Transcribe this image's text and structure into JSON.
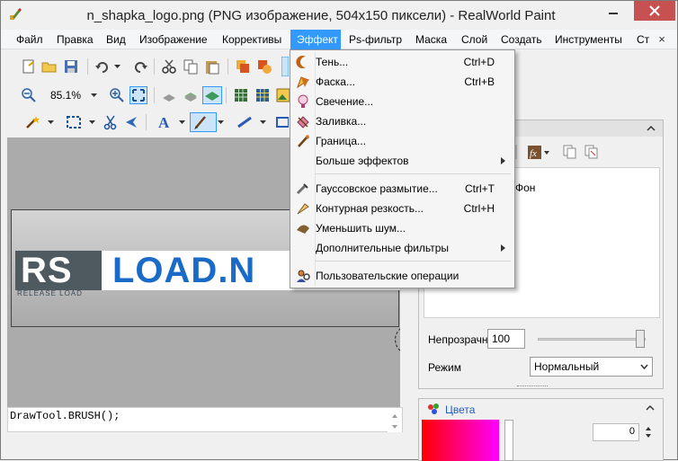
{
  "window": {
    "title": "n_shapka_logo.png (PNG изображение, 504x150 пиксели) - RealWorld Paint"
  },
  "menubar": {
    "items": [
      "Файл",
      "Правка",
      "Вид",
      "Изображение",
      "Коррективы",
      "Эффект",
      "Ps-фильтр",
      "Маска",
      "Слой",
      "Создать",
      "Инструменты",
      "Ст"
    ],
    "close": "×"
  },
  "toolbar": {
    "zoom": "85.1%"
  },
  "effect_menu": {
    "items": [
      {
        "label": "Тень...",
        "shortcut": "Ctrl+D",
        "icon": "shadow-icon"
      },
      {
        "label": "Фаска...",
        "shortcut": "Ctrl+B",
        "icon": "bevel-icon"
      },
      {
        "label": "Свечение...",
        "shortcut": "",
        "icon": "glow-icon"
      },
      {
        "label": "Заливка...",
        "shortcut": "",
        "icon": "fill-icon"
      },
      {
        "label": "Граница...",
        "shortcut": "",
        "icon": "border-icon"
      },
      {
        "label": "Больше эффектов",
        "shortcut": "",
        "icon": "",
        "submenu": true
      },
      {
        "label": "Гауссовское размытие...",
        "shortcut": "Ctrl+T",
        "icon": "blur-icon"
      },
      {
        "label": "Контурная резкость...",
        "shortcut": "Ctrl+H",
        "icon": "sharpen-icon"
      },
      {
        "label": "Уменьшить шум...",
        "shortcut": "",
        "icon": "denoise-icon"
      },
      {
        "label": "Дополнительные фильтры",
        "shortcut": "",
        "icon": "",
        "submenu": true
      },
      {
        "label": "Пользовательские операции",
        "shortcut": "",
        "icon": "custom-ops-icon"
      }
    ]
  },
  "canvas": {
    "logo_part1": "RS",
    "logo_part2": "LOAD.N",
    "logo_sub": "RELEASE LOAD"
  },
  "console": {
    "text": "DrawTool.BRUSH();"
  },
  "layers_panel": {
    "background_layer": "Фон",
    "opacity_label": "Непрозрачн",
    "opacity_value": "100",
    "mode_label": "Режим",
    "mode_value": "Нормальный"
  },
  "colors_panel": {
    "title": "Цвета",
    "value": "0"
  },
  "colors": {
    "accent": "#3399ff",
    "close_button": "#c75050"
  }
}
